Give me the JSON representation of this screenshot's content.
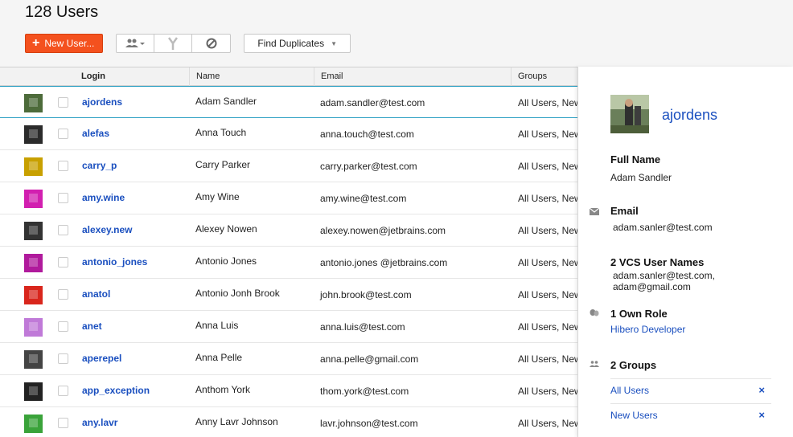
{
  "page": {
    "title": "128 Users"
  },
  "toolbar": {
    "new_user_label": "New User...",
    "find_duplicates_label": "Find Duplicates",
    "icons": [
      "group-dropdown-icon",
      "merge-icon",
      "ban-icon"
    ]
  },
  "table": {
    "columns": [
      "Login",
      "Name",
      "Email",
      "Groups"
    ],
    "rows": [
      {
        "login": "ajordens",
        "name": "Adam Sandler",
        "email": "adam.sandler@test.com",
        "groups": "All Users, New Users",
        "selected": true
      },
      {
        "login": "alefas",
        "name": "Anna Touch",
        "email": "anna.touch@test.com",
        "groups": "All Users, New Users"
      },
      {
        "login": "carry_p",
        "name": "Carry Parker",
        "email": "carry.parker@test.com",
        "groups": "All Users, New Users"
      },
      {
        "login": "amy.wine",
        "name": "Amy Wine",
        "email": "amy.wine@test.com",
        "groups": "All Users, New Users"
      },
      {
        "login": "alexey.new",
        "name": "Alexey Nowen",
        "email": "alexey.nowen@jetbrains.com",
        "groups": "All Users, New Users"
      },
      {
        "login": "antonio_jones",
        "name": "Antonio Jones",
        "email": "antonio.jones @jetbrains.com",
        "groups": "All Users, New Users"
      },
      {
        "login": "anatol",
        "name": "Antonio Jonh Brook",
        "email": "john.brook@test.com",
        "groups": "All Users, New Users"
      },
      {
        "login": "anet",
        "name": "Anna Luis",
        "email": "anna.luis@test.com",
        "groups": "All Users, New Users"
      },
      {
        "login": "aperepel",
        "name": "Anna Pelle",
        "email": "anna.pelle@gmail.com",
        "groups": "All Users, New Users"
      },
      {
        "login": "app_exception",
        "name": "Anthom York",
        "email": "thom.york@test.com",
        "groups": "All Users, New Users"
      },
      {
        "login": "any.lavr",
        "name": "Anny Lavr Johnson",
        "email": "lavr.johnson@test.com",
        "groups": "All Users, New Users"
      }
    ]
  },
  "details": {
    "login": "ajordens",
    "full_name_label": "Full Name",
    "full_name": "Adam Sandler",
    "email_label": "Email",
    "email": "adam.sanler@test.com",
    "vcs_label": "2 VCS User Names",
    "vcs_names": [
      "adam.sanler@test.com,",
      "adam@gmail.com"
    ],
    "role_label": "1 Own Role",
    "role": "Hibero Developer",
    "groups_label": "2 Groups",
    "groups": [
      "All Users",
      "New Users"
    ],
    "remove_glyph": "×"
  },
  "colors": {
    "accent": "#f4511e",
    "link": "#1a4fbf",
    "selection": "#2da0c3"
  }
}
